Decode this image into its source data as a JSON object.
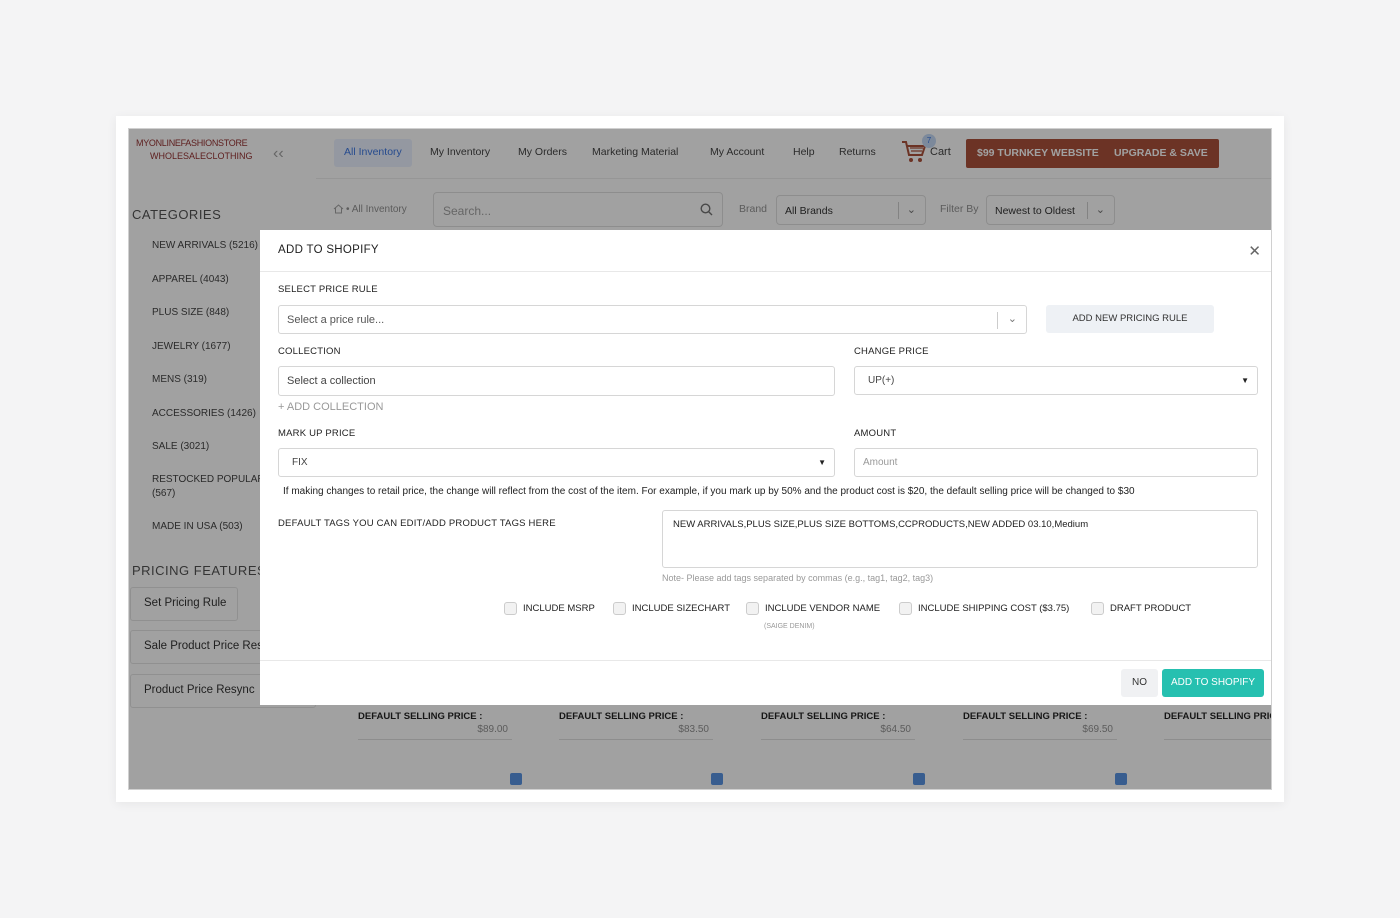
{
  "logo": {
    "line1": "MYONLINEFASHIONSTORE",
    "line2": "WHOLESALECLOTHING"
  },
  "sidebar": {
    "categories_title": "CATEGORIES",
    "categories": [
      "NEW ARRIVALS (5216)",
      "APPAREL (4043)",
      "PLUS SIZE (848)",
      "JEWELRY (1677)",
      "MENS (319)",
      "ACCESSORIES (1426)",
      "SALE (3021)",
      "RESTOCKED POPULAR I",
      "(567)",
      "MADE IN USA (503)"
    ],
    "pricing_title": "PRICING FEATURES",
    "pricing_buttons": [
      "Set Pricing Rule",
      "Sale Product Price Res",
      "Product Price Resync"
    ]
  },
  "nav": {
    "items": [
      "All Inventory",
      "My Inventory",
      "My Orders",
      "Marketing Material",
      "My Account",
      "Help",
      "Returns"
    ],
    "cart_count": "7",
    "cart_label": "Cart",
    "turnkey_button": "$99 TURNKEY WEBSITE",
    "upgrade_button": "UPGRADE & SAVE"
  },
  "filters": {
    "breadcrumb": "All Inventory",
    "search_placeholder": "Search...",
    "brand_label": "Brand",
    "brand_value": "All Brands",
    "filter_label": "Filter By",
    "filter_value": "Newest to Oldest"
  },
  "products": {
    "selling_label": "DEFAULT SELLING PRICE :",
    "cards": [
      {
        "label": "DEFAULT SELLING PRICE :",
        "price": "$89.00"
      },
      {
        "label": "DEFAULT SELLING PRICE :",
        "price": "$83.50"
      },
      {
        "label": "DEFAULT SELLING PRICE :",
        "price": "$64.50"
      },
      {
        "label": "DEFAULT SELLING PRICE :",
        "price": "$69.50"
      },
      {
        "label": "DEFAULT SELLING PRIC",
        "price": ""
      }
    ]
  },
  "modal": {
    "title": "ADD TO SHOPIFY",
    "price_rule_label": "SELECT PRICE RULE",
    "price_rule_placeholder": "Select a price rule...",
    "add_rule_button": "ADD NEW PRICING RULE",
    "collection_label": "COLLECTION",
    "collection_placeholder": "Select a collection",
    "add_collection": "+ ADD COLLECTION",
    "change_price_label": "CHANGE PRICE",
    "change_price_value": "UP(+)",
    "markup_label": "MARK UP PRICE",
    "markup_value": "FIX",
    "amount_label": "AMOUNT",
    "amount_placeholder": "Amount",
    "note": "If making changes to retail price, the change will reflect from the cost of the item. For example, if you mark up by 50% and the product cost is $20, the default selling price will be changed to $30",
    "tags_label": "DEFAULT TAGS YOU CAN EDIT/ADD PRODUCT TAGS HERE",
    "tags_value": "NEW ARRIVALS,PLUS SIZE,PLUS SIZE BOTTOMS,CCPRODUCTS,NEW ADDED 03.10,Medium",
    "tags_note": "Note- Please add tags separated by commas (e.g., tag1, tag2, tag3)",
    "checkboxes": [
      "INCLUDE MSRP",
      "INCLUDE SIZECHART",
      "INCLUDE VENDOR NAME",
      "INCLUDE SHIPPING COST ($3.75)",
      "DRAFT PRODUCT"
    ],
    "vendor_sub": "(SAIGE DENIM)",
    "no_button": "NO",
    "add_button": "ADD TO SHOPIFY"
  }
}
